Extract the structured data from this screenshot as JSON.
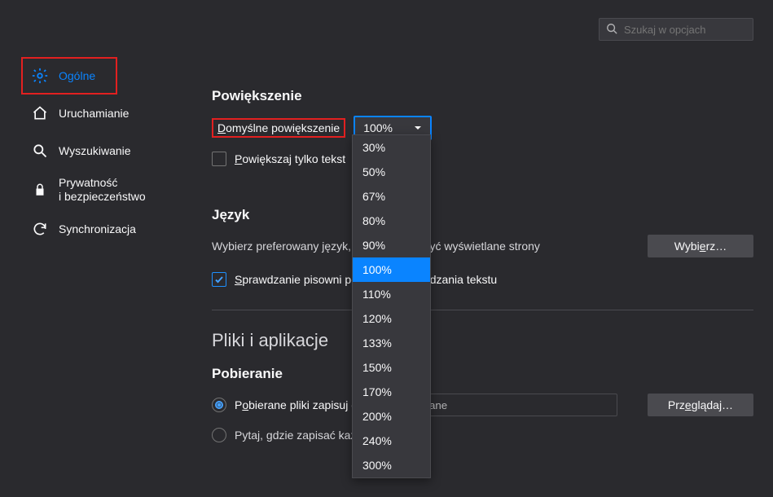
{
  "search": {
    "placeholder": "Szukaj w opcjach"
  },
  "sidebar": {
    "items": [
      {
        "label": "Ogólne"
      },
      {
        "label": "Uruchamianie"
      },
      {
        "label": "Wyszukiwanie"
      },
      {
        "label1": "Prywatność",
        "label2": "i bezpieczeństwo"
      },
      {
        "label": "Synchronizacja"
      }
    ]
  },
  "zoom": {
    "heading": "Powiększenie",
    "label_pre": "D",
    "label_rest": "omyślne powiększenie",
    "selected": "100%",
    "options": [
      "30%",
      "50%",
      "67%",
      "80%",
      "90%",
      "100%",
      "110%",
      "120%",
      "133%",
      "150%",
      "170%",
      "200%",
      "240%",
      "300%"
    ],
    "selected_index": 5,
    "text_only_pre": "P",
    "text_only_rest": "owiększaj tylko tekst",
    "text_only_checked": false
  },
  "lang": {
    "heading": "Język",
    "desc": "Wybierz preferowany język, w jakim mają być wyświetlane strony",
    "choose_btn_pre": "Wybi",
    "choose_btn_u": "e",
    "choose_btn_post": "rz…",
    "spellcheck_pre": "S",
    "spellcheck_rest": "prawdzanie pisowni podczas wprowadzania tekstu",
    "spellcheck_checked": true
  },
  "files": {
    "section": "Pliki i aplikacje",
    "heading": "Pobieranie",
    "radio_save_pre": "P",
    "radio_save_mid": "o",
    "radio_save_rest": "bierane pliki zapisuj do:",
    "path_value": "Pobrane",
    "browse_pre": "Prz",
    "browse_u": "e",
    "browse_post": "glądaj…",
    "radio_ask": "Pytaj, gdzie zapisać każdy plik",
    "selected_radio": 0
  }
}
